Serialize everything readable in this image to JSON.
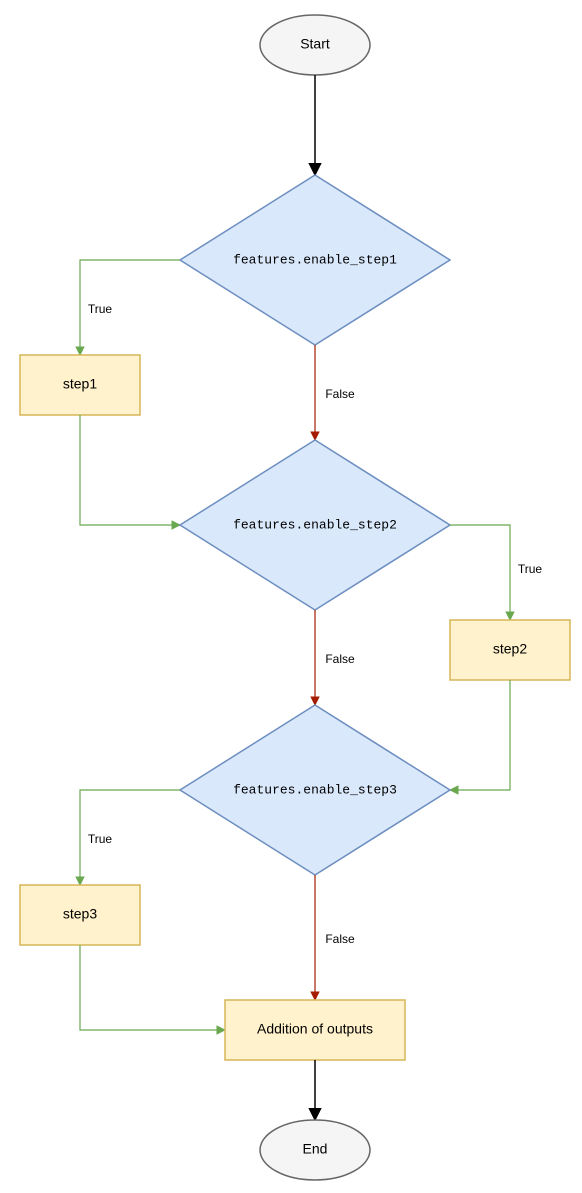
{
  "chart_data": {
    "type": "flowchart",
    "nodes": [
      {
        "id": "start",
        "type": "terminal",
        "label": "Start"
      },
      {
        "id": "d1",
        "type": "decision",
        "label": "features.enable_step1"
      },
      {
        "id": "p1",
        "type": "process",
        "label": "step1"
      },
      {
        "id": "d2",
        "type": "decision",
        "label": "features.enable_step2"
      },
      {
        "id": "p2",
        "type": "process",
        "label": "step2"
      },
      {
        "id": "d3",
        "type": "decision",
        "label": "features.enable_step3"
      },
      {
        "id": "p3",
        "type": "process",
        "label": "step3"
      },
      {
        "id": "sum",
        "type": "process",
        "label": "Addition of outputs"
      },
      {
        "id": "end",
        "type": "terminal",
        "label": "End"
      }
    ],
    "edges": [
      {
        "from": "start",
        "to": "d1",
        "label": ""
      },
      {
        "from": "d1",
        "to": "p1",
        "label": "True"
      },
      {
        "from": "d1",
        "to": "d2",
        "label": "False"
      },
      {
        "from": "p1",
        "to": "d2",
        "label": ""
      },
      {
        "from": "d2",
        "to": "p2",
        "label": "True"
      },
      {
        "from": "d2",
        "to": "d3",
        "label": "False"
      },
      {
        "from": "p2",
        "to": "d3",
        "label": ""
      },
      {
        "from": "d3",
        "to": "p3",
        "label": "True"
      },
      {
        "from": "d3",
        "to": "sum",
        "label": "False"
      },
      {
        "from": "p3",
        "to": "sum",
        "label": ""
      },
      {
        "from": "sum",
        "to": "end",
        "label": ""
      }
    ]
  },
  "labels": {
    "true": "True",
    "false": "False"
  }
}
